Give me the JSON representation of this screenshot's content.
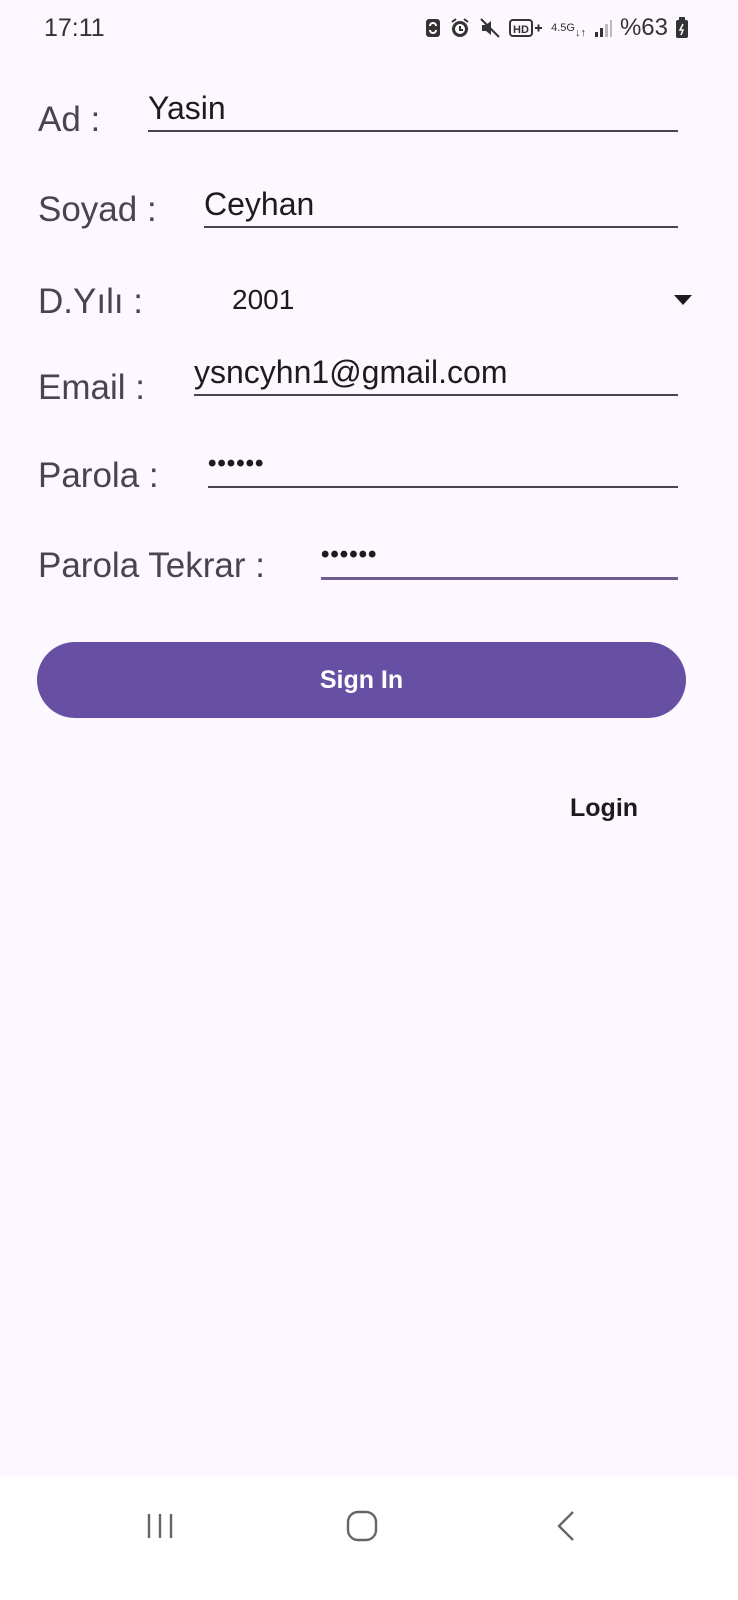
{
  "status_bar": {
    "time": "17:11",
    "network": "4.5G",
    "battery": "%63",
    "icons": [
      "sync-icon",
      "alarm-icon",
      "mute-icon",
      "hd-voice-icon",
      "network-4.5g-icon",
      "signal-icon",
      "battery-icon"
    ]
  },
  "form": {
    "ad": {
      "label": "Ad :",
      "value": "Yasin"
    },
    "soyad": {
      "label": "Soyad :",
      "value": "Ceyhan"
    },
    "dyili": {
      "label": "D.Yılı :",
      "value": "2001"
    },
    "email": {
      "label": "Email :",
      "value": "ysncyhn1@gmail.com"
    },
    "parola": {
      "label": "Parola :",
      "value": "••••••"
    },
    "parola_tekrar": {
      "label": "Parola Tekrar :",
      "value": "••••••"
    }
  },
  "actions": {
    "signin_label": "Sign In",
    "login_label": "Login"
  },
  "nav": {
    "items": [
      "recent-apps-icon",
      "home-icon",
      "back-icon"
    ]
  },
  "colors": {
    "background": "#fdf7ff",
    "primary": "#6750a4",
    "label": "#49454f",
    "text": "#1c1b1f"
  }
}
